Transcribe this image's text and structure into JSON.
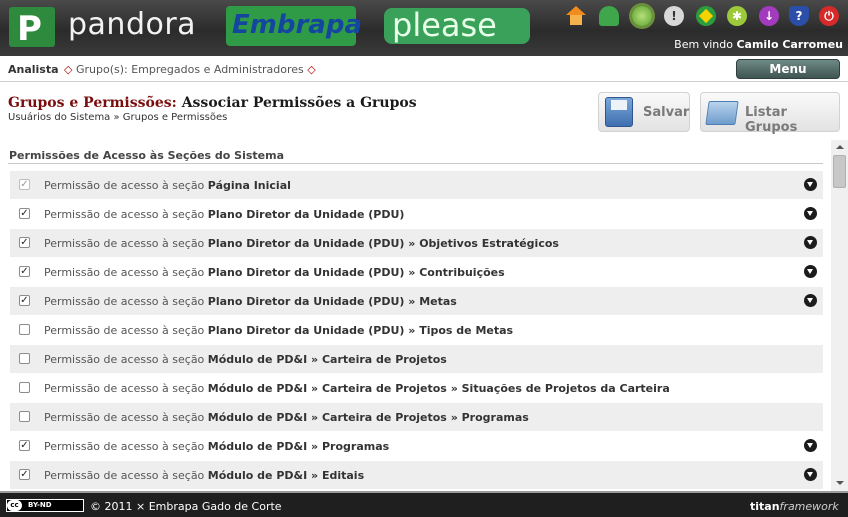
{
  "header": {
    "logo_p": "P",
    "brand_pandora": "pandora",
    "brand_embrapa": "Embrapa",
    "brand_please": "please",
    "welcome_prefix": "Bem vindo",
    "user_name": "Camilo Carromeu",
    "icons": [
      "home-icon",
      "user-icon",
      "globe-icon",
      "alert-icon",
      "brazil-flag-icon",
      "gear-icon",
      "download-icon",
      "help-icon",
      "power-icon"
    ]
  },
  "topbar": {
    "role": "Analista",
    "groups_prefix": "Grupo(s):",
    "groups": "Empregados e Administradores",
    "menu_label": "Menu"
  },
  "page": {
    "title_main": "Grupos e Permissões:",
    "title_sub": "Associar Permissões a Grupos",
    "breadcrumb": "Usuários do Sistema » Grupos e Permissões",
    "save_label": "Salvar",
    "list_label": "Listar Grupos",
    "section_title": "Permissões de Acesso às Seções do Sistema"
  },
  "permissions": [
    {
      "prefix": "Permissão de acesso à seção",
      "path": "Página Inicial",
      "checked": true,
      "disabled": true,
      "expand": true
    },
    {
      "prefix": "Permissão de acesso à seção",
      "path": "Plano Diretor da Unidade (PDU)",
      "checked": true,
      "disabled": false,
      "expand": true
    },
    {
      "prefix": "Permissão de acesso à seção",
      "path": "Plano Diretor da Unidade (PDU) » Objetivos Estratégicos",
      "checked": true,
      "disabled": false,
      "expand": true
    },
    {
      "prefix": "Permissão de acesso à seção",
      "path": "Plano Diretor da Unidade (PDU) » Contribuições",
      "checked": true,
      "disabled": false,
      "expand": true
    },
    {
      "prefix": "Permissão de acesso à seção",
      "path": "Plano Diretor da Unidade (PDU) » Metas",
      "checked": true,
      "disabled": false,
      "expand": true
    },
    {
      "prefix": "Permissão de acesso à seção",
      "path": "Plano Diretor da Unidade (PDU) » Tipos de Metas",
      "checked": false,
      "disabled": false,
      "expand": false
    },
    {
      "prefix": "Permissão de acesso à seção",
      "path": "Módulo de PD&I » Carteira de Projetos",
      "checked": false,
      "disabled": false,
      "expand": false
    },
    {
      "prefix": "Permissão de acesso à seção",
      "path": "Módulo de PD&I » Carteira de Projetos » Situações de Projetos da Carteira",
      "checked": false,
      "disabled": false,
      "expand": false
    },
    {
      "prefix": "Permissão de acesso à seção",
      "path": "Módulo de PD&I » Carteira de Projetos » Programas",
      "checked": false,
      "disabled": false,
      "expand": false
    },
    {
      "prefix": "Permissão de acesso à seção",
      "path": "Módulo de PD&I » Programas",
      "checked": true,
      "disabled": false,
      "expand": true
    },
    {
      "prefix": "Permissão de acesso à seção",
      "path": "Módulo de PD&I » Editais",
      "checked": true,
      "disabled": false,
      "expand": true
    }
  ],
  "footer": {
    "cc_label": "BY-ND",
    "copyright": "© 2011 × Embrapa Gado de Corte",
    "titan": "titan",
    "framework": "framework"
  }
}
